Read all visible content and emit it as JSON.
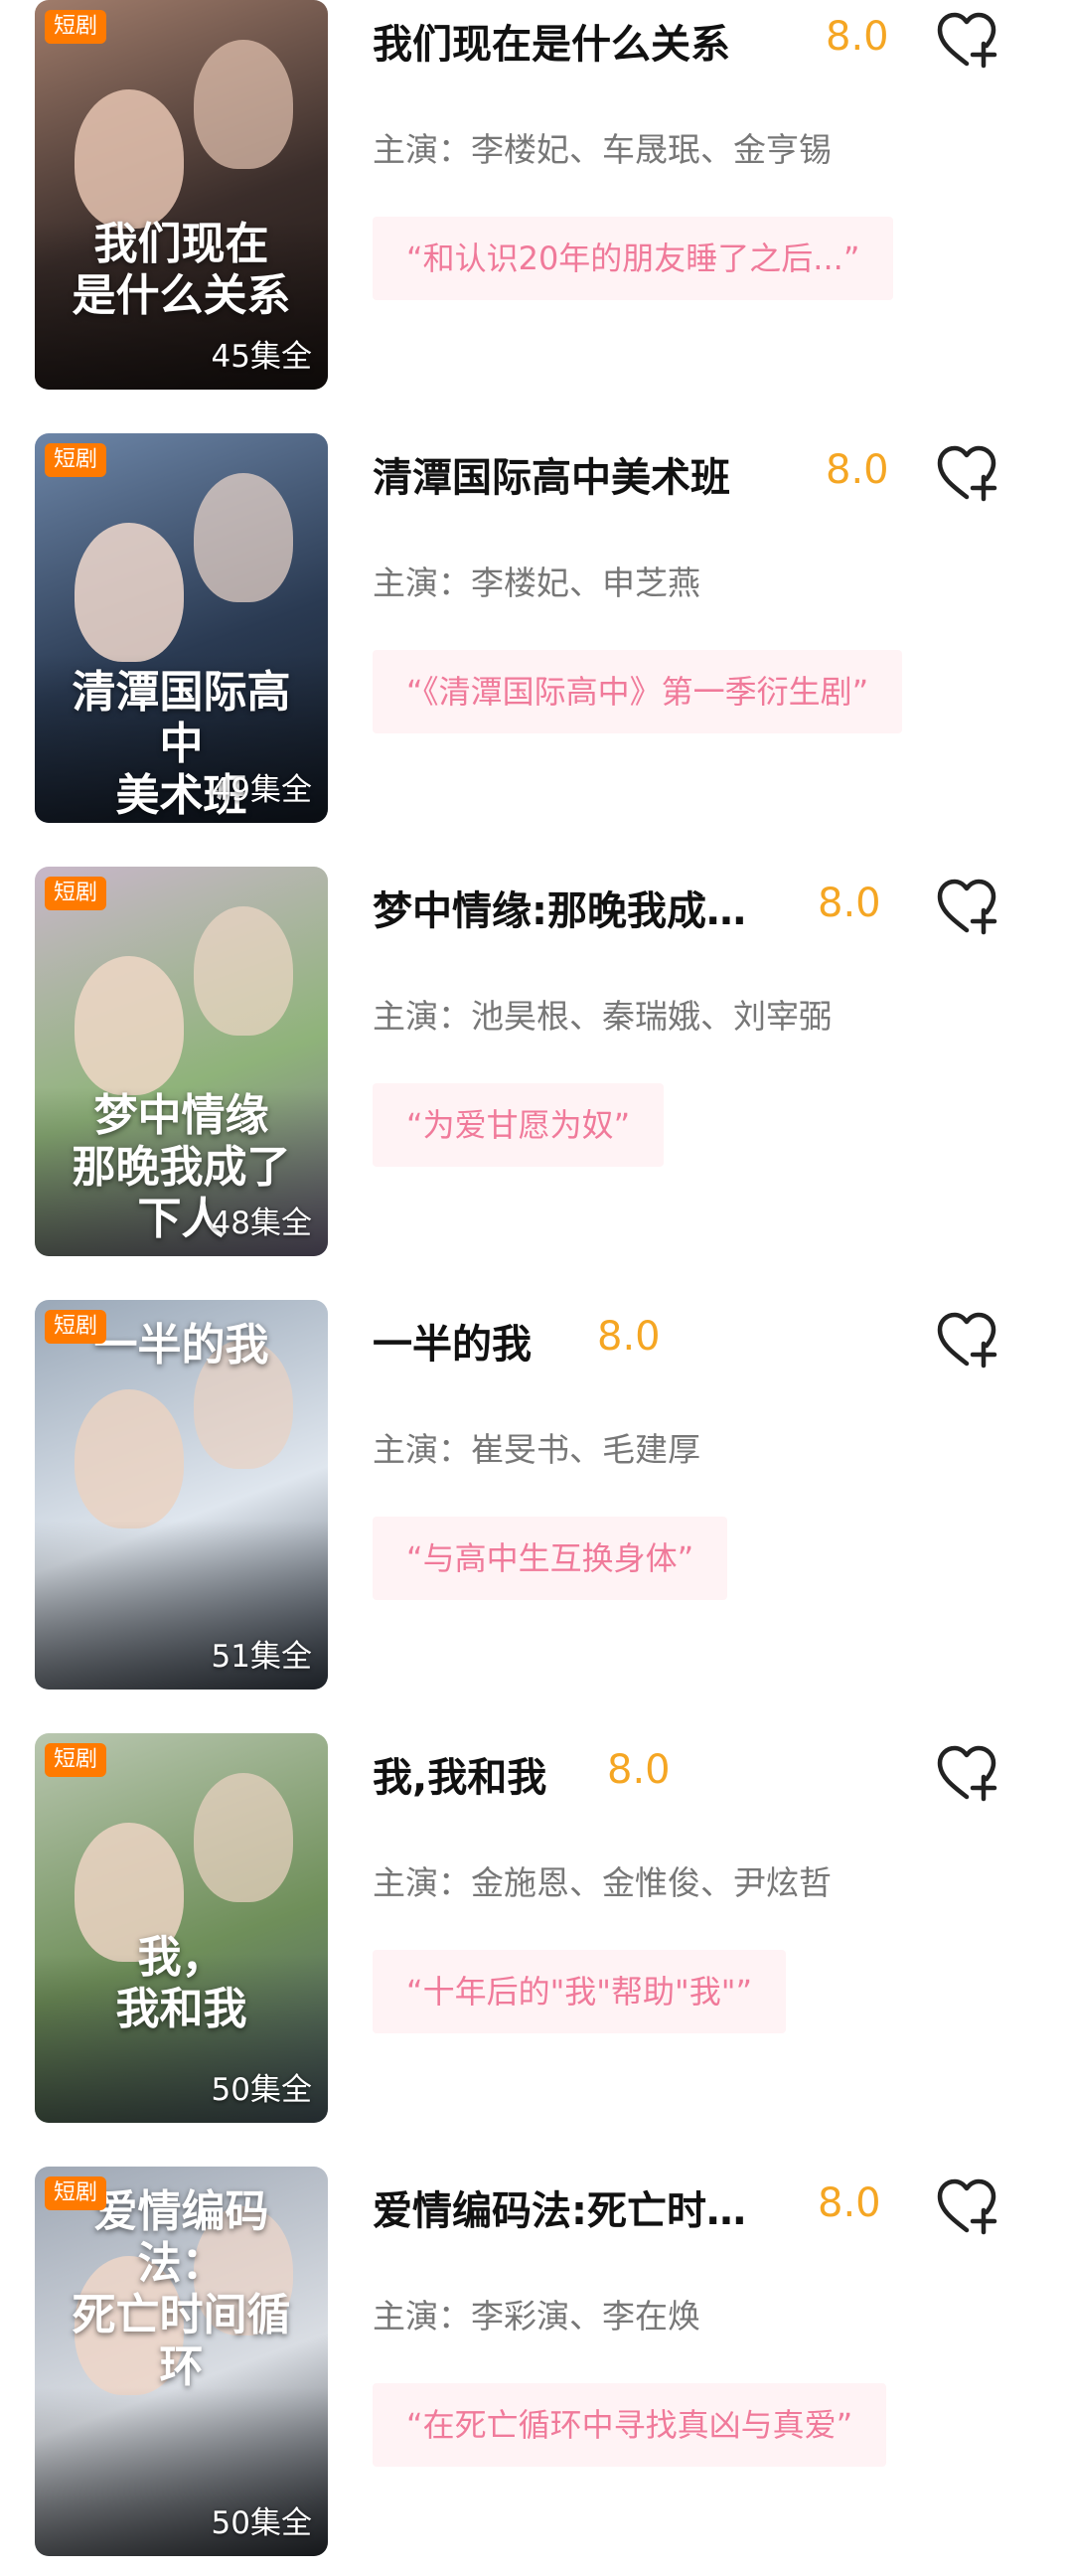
{
  "items": [
    {
      "tag": "短剧",
      "poster_title": "我们现在\n是什么关系",
      "episodes": "45集全",
      "title": "我们现在是什么关系",
      "score": "8.0",
      "cast": "主演：李楼妃、车晟珉、金亨锡",
      "quote": "“和认识20年的朋友睡了之后...”",
      "colors": {
        "bg1": "#3a2d2a",
        "bg2": "#a07c6b",
        "bg3": "#1c1412",
        "skin": "#e6c4b2"
      }
    },
    {
      "tag": "短剧",
      "poster_title": "清潭国际高中\n美术班",
      "episodes": "49集全",
      "title": "清潭国际高中美术班",
      "score": "8.0",
      "cast": "主演：李楼妃、申芝燕",
      "quote": "“《清潭国际高中》第一季衍生剧”",
      "colors": {
        "bg1": "#2a3a52",
        "bg2": "#6d86a8",
        "bg3": "#141c28",
        "skin": "#f0d8cc"
      }
    },
    {
      "tag": "短剧",
      "poster_title": "梦中情缘\n那晚我成了下人",
      "episodes": "48集全",
      "title": "梦中情缘:那晚我成…",
      "score": "8.0",
      "cast": "主演：池昊根、秦瑞娥、刘宰弼",
      "quote": "“为爱甘愿为奴”",
      "colors": {
        "bg1": "#8fb37a",
        "bg2": "#c8b7c9",
        "bg3": "#7a6f8c",
        "skin": "#efd7c6"
      }
    },
    {
      "tag": "短剧",
      "poster_title": "一半的我",
      "episodes": "51集全",
      "title": "一半的我",
      "score": "8.0",
      "cast": "主演：崔旻书、毛建厚",
      "quote": "“与高中生互换身体”",
      "colors": {
        "bg1": "#dfe6ee",
        "bg2": "#9aa8b8",
        "bg3": "#3d4652",
        "skin": "#ead2c2"
      }
    },
    {
      "tag": "短剧",
      "poster_title": "我，\n我和我",
      "episodes": "50集全",
      "title": "我,我和我",
      "score": "8.0",
      "cast": "主演：金施恩、金惟俊、尹炫哲",
      "quote": "“十年后的\"我\"帮助\"我\"”",
      "colors": {
        "bg1": "#6f8f5a",
        "bg2": "#b9c7b0",
        "bg3": "#4d5d66",
        "skin": "#ecd3c3"
      }
    },
    {
      "tag": "短剧",
      "poster_title": "爱情编码法：\n死亡时间循环",
      "episodes": "50集全",
      "title": "爱情编码法:死亡时…",
      "score": "8.0",
      "cast": "主演：李彩演、李在焕",
      "quote": "“在死亡循环中寻找真凶与真爱”",
      "colors": {
        "bg1": "#d9dde3",
        "bg2": "#9fa8b5",
        "bg3": "#2f343b",
        "skin": "#efd6c8"
      }
    }
  ]
}
